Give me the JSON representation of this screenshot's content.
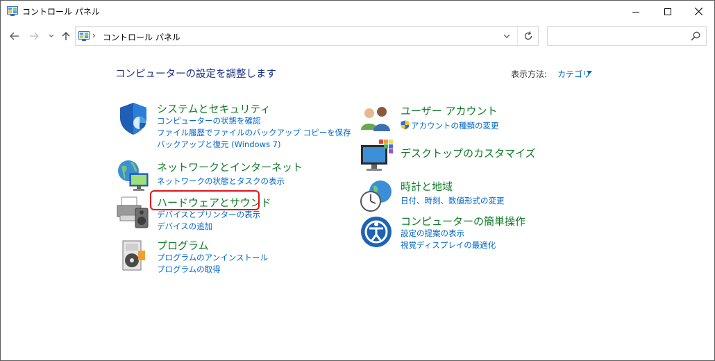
{
  "window": {
    "title": "コントロール パネル",
    "icon": "control-panel-icon"
  },
  "controls": {
    "minimize": "minimize-icon",
    "maximize": "maximize-icon",
    "close": "close-icon"
  },
  "nav": {
    "back": "back-arrow-icon",
    "forward": "forward-arrow-icon",
    "recent": "chevron-down-icon",
    "up": "up-arrow-icon"
  },
  "address": {
    "separator": "›",
    "path": "コントロール パネル",
    "trailing_separator": "›"
  },
  "search": {
    "value": "",
    "icon": "search-icon"
  },
  "main": {
    "heading": "コンピューターの設定を調整します",
    "view_by_label": "表示方法:",
    "view_by_value": "カテゴリ"
  },
  "categories": {
    "system": {
      "title": "システムとセキュリティ",
      "icon": "shield-icon",
      "links": [
        "コンピューターの状態を確認",
        "ファイル履歴でファイルのバックアップ コピーを保存",
        "バックアップと復元 (Windows 7)"
      ]
    },
    "network": {
      "title": "ネットワークとインターネット",
      "icon": "network-globe-icon",
      "links": [
        "ネットワークの状態とタスクの表示"
      ]
    },
    "hardware": {
      "title": "ハードウェアとサウンド",
      "icon": "printer-speaker-icon",
      "links": [
        "デバイスとプリンターの表示",
        "デバイスの追加"
      ]
    },
    "programs": {
      "title": "プログラム",
      "icon": "programs-disk-icon",
      "links": [
        "プログラムのアンインストール",
        "プログラムの取得"
      ]
    },
    "users": {
      "title": "ユーザー アカウント",
      "icon": "users-icon",
      "links": [
        "アカウントの種類の変更"
      ]
    },
    "appearance": {
      "title": "デスクトップのカスタマイズ",
      "icon": "monitor-palette-icon",
      "links": []
    },
    "clock": {
      "title": "時計と地域",
      "icon": "clock-globe-icon",
      "links": [
        "日付、時刻、数値形式の変更"
      ]
    },
    "access": {
      "title": "コンピューターの簡単操作",
      "icon": "ease-of-access-icon",
      "links": [
        "設定の提案の表示",
        "視覚ディスプレイの最適化"
      ]
    }
  },
  "colors": {
    "category_title": "#0e7a25",
    "link": "#0066cc",
    "heading": "#1e3287",
    "highlight": "#e0161a"
  }
}
